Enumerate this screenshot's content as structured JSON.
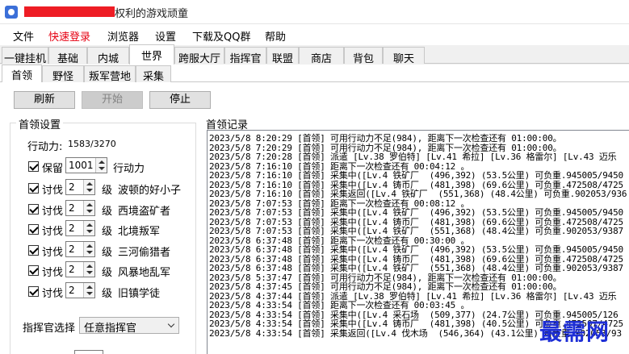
{
  "window": {
    "title": "权利的游戏顽童"
  },
  "menu": [
    "文件",
    "快速登录",
    "浏览器",
    "设置",
    "下载及QQ群",
    "帮助"
  ],
  "menu_colors": {
    "quick_login": "#e60012"
  },
  "tabs": [
    "一键挂机",
    "基础",
    "内城",
    "世界",
    "跨服大厅",
    "指挥官",
    "联盟",
    "商店",
    "背包",
    "聊天"
  ],
  "active_tab": "世界",
  "subtabs": [
    "首领",
    "野怪",
    "叛军营地",
    "采集"
  ],
  "active_subtab": "首领",
  "buttons": {
    "refresh": "刷新",
    "start": "开始",
    "stop": "停止"
  },
  "settings": {
    "title": "首领设置",
    "stamina_label": "行动力:",
    "stamina_value": "1583/3270",
    "keep": {
      "label": "保留",
      "value": "1001",
      "suffix": "行动力"
    },
    "crusades": [
      {
        "label": "讨伐",
        "level": "2",
        "unit": "级",
        "target": "波顿的好小子"
      },
      {
        "label": "讨伐",
        "level": "2",
        "unit": "级",
        "target": "西境盗矿者"
      },
      {
        "label": "讨伐",
        "level": "2",
        "unit": "级",
        "target": "北境叛军"
      },
      {
        "label": "讨伐",
        "level": "2",
        "unit": "级",
        "target": "三河偷猎者"
      },
      {
        "label": "讨伐",
        "level": "2",
        "unit": "级",
        "target": "风暴地乱军"
      },
      {
        "label": "讨伐",
        "level": "2",
        "unit": "级",
        "target": "旧镇学徒"
      }
    ],
    "commander_label": "指挥官选择",
    "commander_value": "任意指挥官"
  },
  "log": {
    "title": "首领记录",
    "lines": [
      "2023/5/8 8:20:29 [首领] 可用行动力不足(984), 距离下一次检查还有 01:00:00。",
      "2023/5/8 7:20:29 [首领] 可用行动力不足(984), 距离下一次检查还有 01:00:00。",
      "2023/5/8 7:20:28 [首领] 派遣 [Lv.38 罗伯特] [Lv.41 希拉] [Lv.36 格雷尔] [Lv.43 迈乐",
      "2023/5/8 7:16:10 [首领] 距离下一次检查还有 00:04:12 。",
      "2023/5/8 7:16:10 [首领] 采集中([Lv.4 铁矿厂  (496,392) (53.5公里) 可负重.945005/9450",
      "2023/5/8 7:16:10 [首领] 采集中([Lv.4 铸币厂  (481,398) (69.6公里) 可负重.472508/4725",
      "2023/5/8 7:16:10 [首领] 采集返回([Lv.4 铁矿厂  (551,368) (48.4公里) 可负重.902053/936",
      "2023/5/8 7:07:53 [首领] 距离下一次检查还有 00:08:12 。",
      "2023/5/8 7:07:53 [首领] 采集中([Lv.4 铁矿厂  (496,392) (53.5公里) 可负重.945005/9450",
      "2023/5/8 7:07:53 [首领] 采集中([Lv.4 铸币厂  (481,398) (69.6公里) 可负重.472508/4725",
      "2023/5/8 7:07:53 [首领] 采集中([Lv.4 铁矿厂  (551,368) (48.4公里) 可负重.902053/9387",
      "2023/5/8 6:37:48 [首领] 距离下一次检查还有 00:30:00 。",
      "2023/5/8 6:37:48 [首领] 采集中([Lv.4 铁矿厂  (496,392) (53.5公里) 可负重.945005/9450",
      "2023/5/8 6:37:48 [首领] 采集中([Lv.4 铸币厂  (481,398) (69.6公里) 可负重.472508/4725",
      "2023/5/8 6:37:48 [首领] 采集中([Lv.4 铁矿厂  (551,368) (48.4公里) 可负重.902053/9387",
      "2023/5/8 5:37:47 [首领] 可用行动力不足(984), 距离下一次检查还有 01:00:00。",
      "2023/5/8 4:37:45 [首领] 可用行动力不足(984), 距离下一次检查还有 01:00:00。",
      "2023/5/8 4:37:44 [首领] 派遣 [Lv.38 罗伯特] [Lv.41 希拉] [Lv.36 格雷尔] [Lv.43 迈乐",
      "2023/5/8 4:33:54 [首领] 距离下一次检查还有 00:03:45 。",
      "2023/5/8 4:33:54 [首领] 采集中([Lv.4 采石场  (509,377) (24.7公里) 可负重.945005/126",
      "2023/5/8 4:33:54 [首领] 采集中([Lv.4 铸币厂  (481,398) (40.5公里) 可负重.472507/4725",
      "2023/5/8 4:33:54 [首领] 采集返回([Lv.4 伐木场  (546,364) (43.1公里) 可负重.902053/93"
    ]
  },
  "watermark": "最需网"
}
